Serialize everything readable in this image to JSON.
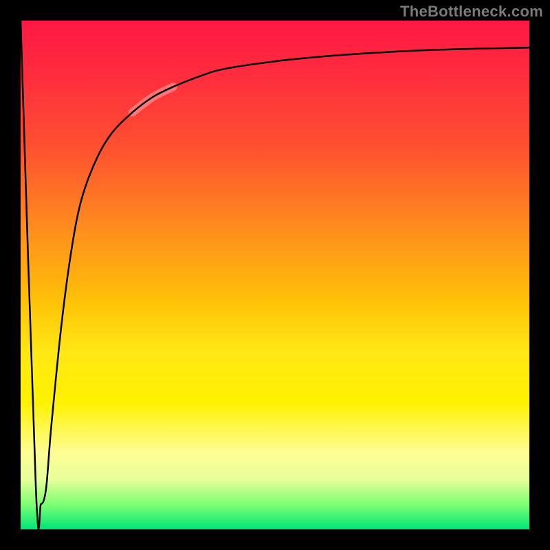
{
  "attribution": "TheBottleneck.com",
  "chart_data": {
    "type": "line",
    "title": "",
    "xlabel": "",
    "ylabel": "",
    "xlim": [
      0,
      100
    ],
    "ylim": [
      0,
      100
    ],
    "grid": false,
    "legend": false,
    "background": "vertical-gradient red→yellow→green",
    "series": [
      {
        "name": "curve",
        "x": [
          0,
          3,
          4,
          5,
          6,
          8,
          10,
          12,
          15,
          18,
          22,
          26,
          30,
          35,
          40,
          50,
          60,
          70,
          80,
          90,
          100
        ],
        "y": [
          100,
          8,
          5,
          8,
          20,
          40,
          55,
          65,
          73,
          78,
          82,
          85,
          87,
          89,
          90.5,
          92,
          93,
          93.7,
          94.2,
          94.5,
          94.7
        ]
      }
    ],
    "highlight_range_x": [
      21,
      29
    ]
  }
}
